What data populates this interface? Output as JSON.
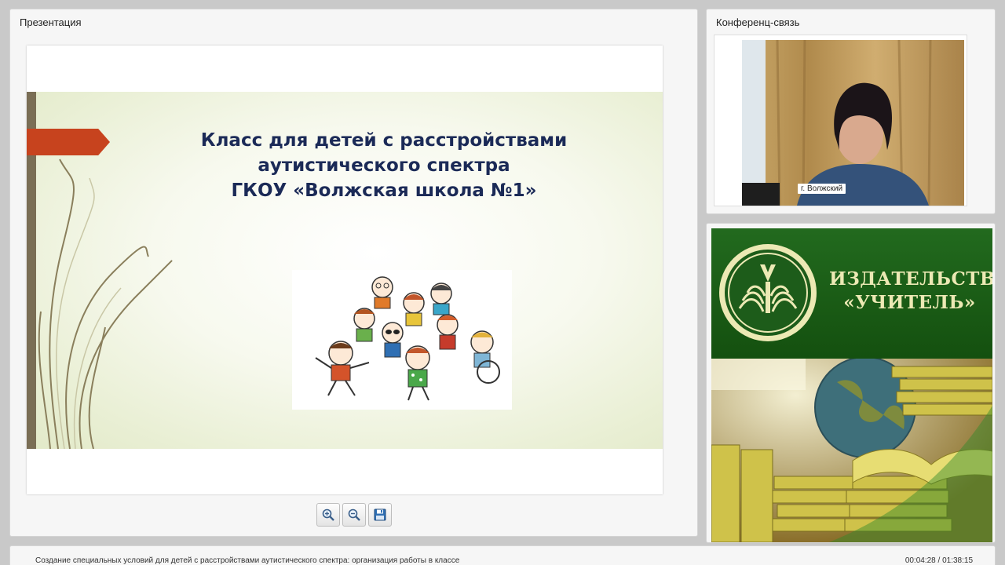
{
  "presentation": {
    "panel_title": "Презентация",
    "slide": {
      "title_lines": [
        "Класс для детей с расстройствами",
        "аутистического спектра",
        "ГКОУ «Волжская школа №1»"
      ]
    },
    "toolbar": {
      "zoom_in_icon": "zoom-in-icon",
      "zoom_out_icon": "zoom-out-icon",
      "save_icon": "save-icon"
    }
  },
  "conference": {
    "panel_title": "Конференц-связь",
    "video_label": "г. Волжский"
  },
  "ad": {
    "lines": [
      "ИЗДАТЕЛЬСТВО",
      "«УЧИТЕЛЬ»"
    ],
    "colors": {
      "green": "#1d5c1a",
      "cream": "#ece9b4"
    }
  },
  "footer": {
    "title": "Создание специальных условий для детей с расстройствами аутистического спектра: организация работы в классе",
    "time": "00:04:28 / 01:38:15"
  },
  "colors": {
    "slide_title": "#1b2a57",
    "slide_arrow": "#c7431e",
    "panel_bg": "#f6f6f6"
  }
}
